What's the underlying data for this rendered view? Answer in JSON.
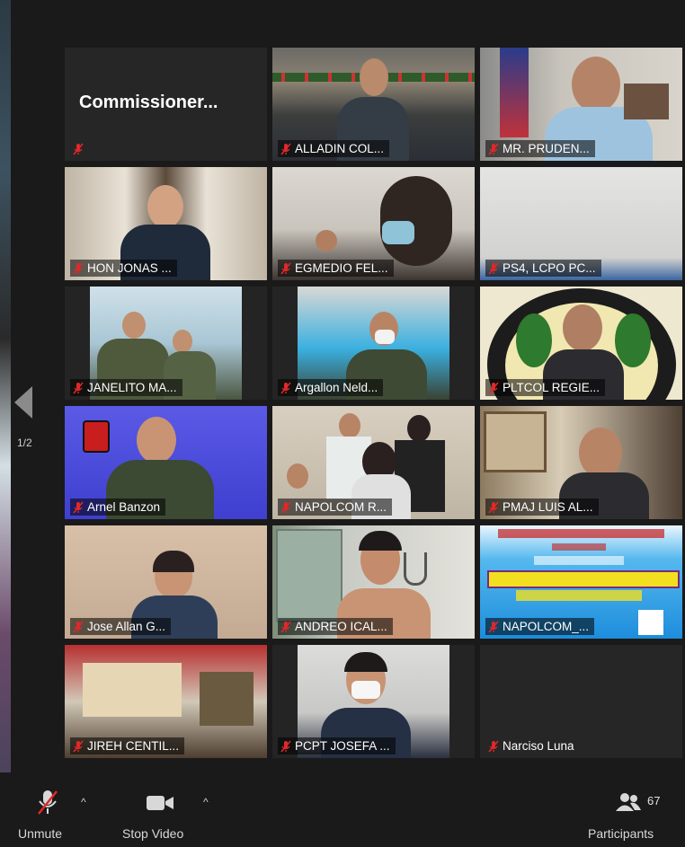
{
  "meeting": {
    "page_indicator": "1/2",
    "participant_count": "67"
  },
  "tiles": [
    {
      "name": "Commissioner...",
      "big_name": "Commissioner...",
      "muted": true
    },
    {
      "name": "ALLADIN COL...",
      "muted": true
    },
    {
      "name": "MR. PRUDEN...",
      "muted": true
    },
    {
      "name": "HON JONAS ...",
      "muted": true
    },
    {
      "name": "EGMEDIO FEL...",
      "muted": true
    },
    {
      "name": "PS4, LCPO PC...",
      "muted": true
    },
    {
      "name": "JANELITO MA...",
      "muted": true
    },
    {
      "name": "Argallon Neld...",
      "muted": true
    },
    {
      "name": "PLTCOL REGIE...",
      "muted": true
    },
    {
      "name": "Arnel Banzon",
      "muted": true
    },
    {
      "name": "NAPOLCOM R...",
      "muted": true
    },
    {
      "name": "PMAJ LUIS AL...",
      "muted": true
    },
    {
      "name": "Jose Allan G...",
      "muted": true
    },
    {
      "name": "ANDREO ICAL...",
      "muted": true
    },
    {
      "name": "NAPOLCOM_...",
      "muted": true
    },
    {
      "name": "JIREH CENTIL...",
      "muted": true
    },
    {
      "name": "PCPT JOSEFA ...",
      "muted": true
    },
    {
      "name": "Narciso Luna",
      "muted": true
    }
  ],
  "toolbar": {
    "unmute_label": "Unmute",
    "stop_video_label": "Stop Video",
    "participants_label": "Participants"
  },
  "colors": {
    "background": "#1a1a1a",
    "mute_red": "#e02828",
    "label_text": "#ffffff"
  }
}
